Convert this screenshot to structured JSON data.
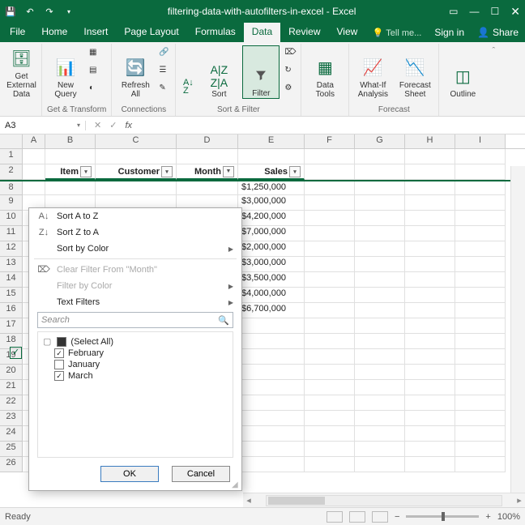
{
  "titlebar": {
    "title": "filtering-data-with-autofilters-in-excel - Excel"
  },
  "menu": {
    "items": [
      "File",
      "Home",
      "Insert",
      "Page Layout",
      "Formulas",
      "Data",
      "Review",
      "View"
    ],
    "active": "Data",
    "tellme": "Tell me...",
    "signin": "Sign in",
    "share": "Share"
  },
  "ribbon": {
    "getexternal": "Get External\nData",
    "newquery": "New\nQuery",
    "refreshall": "Refresh\nAll",
    "sort": "Sort",
    "filter": "Filter",
    "datatools": "Data\nTools",
    "whatif": "What-If\nAnalysis",
    "forecastsheet": "Forecast\nSheet",
    "outline": "Outline",
    "group_gettransform": "Get & Transform",
    "group_connections": "Connections",
    "group_sortfilter": "Sort & Filter",
    "group_forecast": "Forecast",
    "sidequeries": [
      "Show Queries",
      "From Table",
      "Recent Sources"
    ],
    "sideconn": [
      "Connections",
      "Properties",
      "Edit Links"
    ],
    "sidefilter": [
      "Clear",
      "Reapply",
      "Advanced"
    ]
  },
  "namebox": {
    "ref": "A3"
  },
  "columns": [
    "A",
    "B",
    "C",
    "D",
    "E",
    "F",
    "G",
    "H",
    "I"
  ],
  "headers": {
    "item": "Item",
    "customer": "Customer",
    "month": "Month",
    "sales": "Sales"
  },
  "rows": {
    "visible_numbers": [
      "1",
      "2",
      "8",
      "9",
      "10",
      "11",
      "12",
      "13",
      "14",
      "15",
      "16",
      "17",
      "18",
      "19",
      "20",
      "21",
      "22",
      "23",
      "24",
      "25",
      "26"
    ],
    "sales": [
      "$1,250,000",
      "$3,000,000",
      "$4,200,000",
      "$7,000,000",
      "$2,000,000",
      "$3,000,000",
      "$3,500,000",
      "$4,000,000",
      "$6,700,000"
    ]
  },
  "filter": {
    "sort_az": "Sort A to Z",
    "sort_za": "Sort Z to A",
    "sort_color": "Sort by Color",
    "clear": "Clear Filter From \"Month\"",
    "filter_color": "Filter by Color",
    "text_filters": "Text Filters",
    "search_placeholder": "Search",
    "options": [
      {
        "label": "(Select All)",
        "state": "mixed"
      },
      {
        "label": "February",
        "state": "checked"
      },
      {
        "label": "January",
        "state": "unchecked"
      },
      {
        "label": "March",
        "state": "checked"
      }
    ],
    "ok": "OK",
    "cancel": "Cancel"
  },
  "statusbar": {
    "ready": "Ready",
    "zoom": "100%"
  }
}
